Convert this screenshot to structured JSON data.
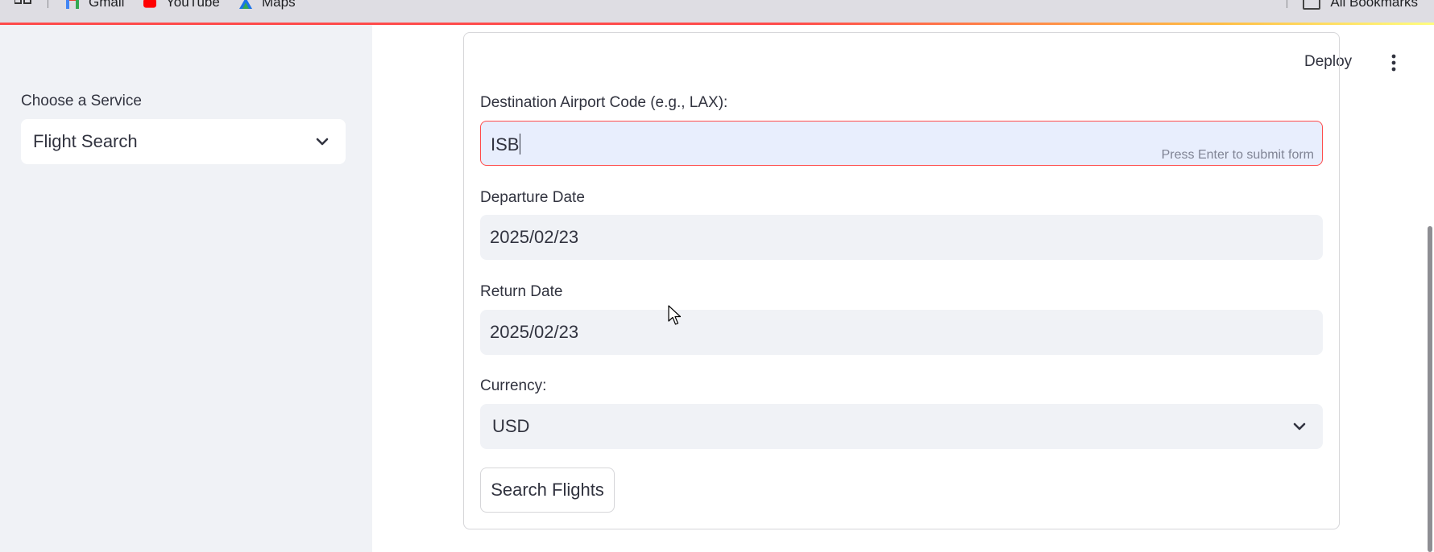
{
  "browser": {
    "bookmarks": [
      "Gmail",
      "YouTube",
      "Maps"
    ],
    "all_bookmarks_label": "All Bookmarks"
  },
  "sidebar": {
    "label": "Choose a Service",
    "service_value": "Flight Search"
  },
  "header": {
    "deploy_label": "Deploy"
  },
  "form": {
    "destination": {
      "label": "Destination Airport Code (e.g., LAX):",
      "value": "ISB",
      "hint": "Press Enter to submit form"
    },
    "departure": {
      "label": "Departure Date",
      "value": "2025/02/23"
    },
    "return": {
      "label": "Return Date",
      "value": "2025/02/23"
    },
    "currency": {
      "label": "Currency:",
      "value": "USD"
    },
    "submit_label": "Search Flights"
  },
  "colors": {
    "accent": "#ff4b4b",
    "sidebar_bg": "#f0f2f6",
    "input_bg": "#f0f2f6",
    "focused_input_bg": "#e8eefd"
  },
  "icons": [
    "apps-grid-icon",
    "gmail-icon",
    "youtube-icon",
    "maps-icon",
    "bookmarks-folder-icon",
    "chevron-down-icon",
    "kebab-menu-icon",
    "mouse-cursor-icon"
  ]
}
